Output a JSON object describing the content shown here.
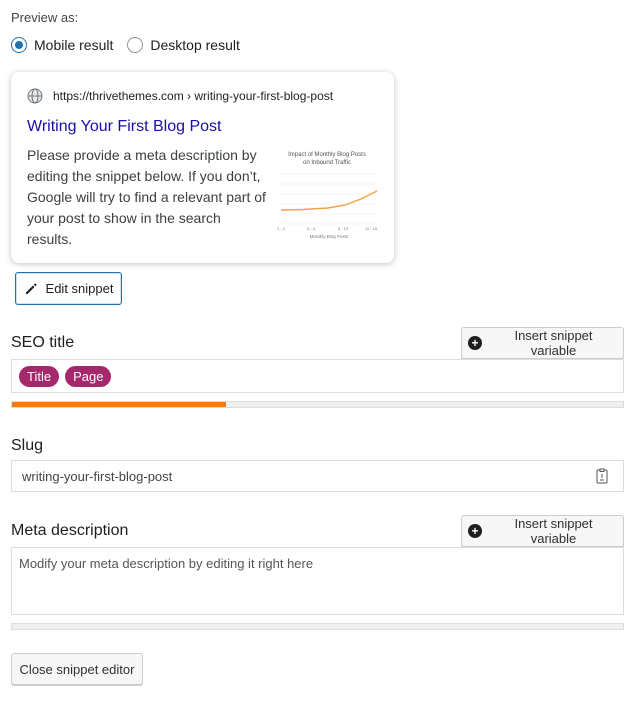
{
  "preview": {
    "label": "Preview as:",
    "options": [
      {
        "label": "Mobile result",
        "selected": true
      },
      {
        "label": "Desktop result",
        "selected": false
      }
    ]
  },
  "serp": {
    "url": "https://thrivethemes.com › writing-your-first-blog-post",
    "title": "Writing Your First Blog Post",
    "description": "Please provide a meta description by editing the snippet below. If you don’t, Google will try to find a relevant part of your post to show in the search results.",
    "thumbnail": {
      "title_line1": "Impact of Monthly Blog Posts",
      "title_line2": "on Inbound Traffic",
      "x_ticks": [
        "1 - 2",
        "3 - 4",
        "5 - 10",
        "11 - 15"
      ],
      "x_label": "Monthly Blog Posts",
      "line_color": "#f5a04a"
    }
  },
  "edit_snippet_label": "Edit snippet",
  "seo_title": {
    "label": "SEO title",
    "insert_variable_label": "Insert snippet variable",
    "variables": [
      "Title",
      "Page"
    ],
    "progress_fraction": 0.35,
    "progress_color": "#ee7c1b"
  },
  "slug": {
    "label": "Slug",
    "value": "writing-your-first-blog-post"
  },
  "meta_description": {
    "label": "Meta description",
    "insert_variable_label": "Insert snippet variable",
    "placeholder": "Modify your meta description by editing it right here",
    "progress_fraction": 0
  },
  "close_label": "Close snippet editor",
  "colors": {
    "accent": "#2271b1",
    "link": "#1a0dab",
    "variable_pill": "#a4286a"
  }
}
